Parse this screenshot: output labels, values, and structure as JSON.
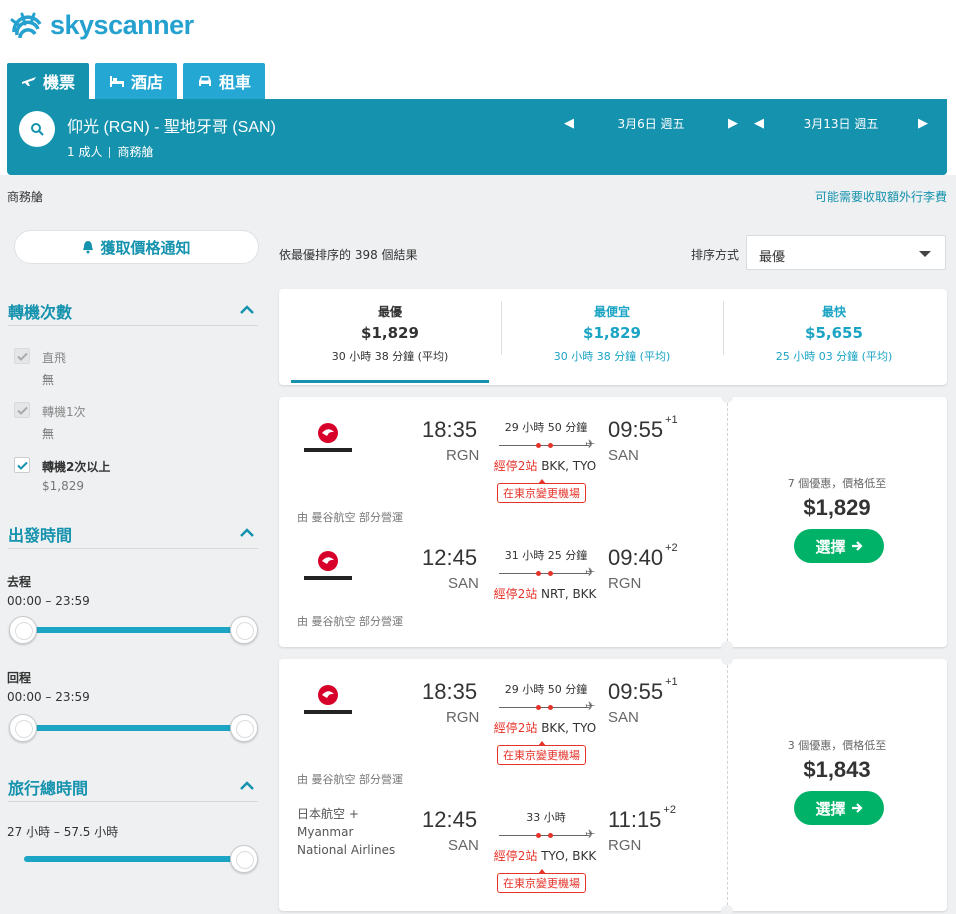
{
  "brand": {
    "name": "skyscanner"
  },
  "tabs": [
    {
      "label": "機票",
      "icon": "plane-icon"
    },
    {
      "label": "酒店",
      "icon": "bed-icon"
    },
    {
      "label": "租車",
      "icon": "car-icon"
    }
  ],
  "search": {
    "route": "仰光 (RGN) - 聖地牙哥 (SAN)",
    "passengers": "1 成人",
    "cabin": "商務艙",
    "depart_date": "3月6日 週五",
    "return_date": "3月13日 週五"
  },
  "subbar": {
    "cabin_label": "商務艙",
    "baggage_link": "可能需要收取額外行李費"
  },
  "sidebar": {
    "alert_button": "獲取價格通知",
    "stops": {
      "title": "轉機次數",
      "options": [
        {
          "label": "直飛",
          "sub": "無",
          "checked": true,
          "disabled": true
        },
        {
          "label": "轉機1次",
          "sub": "無",
          "checked": true,
          "disabled": true
        },
        {
          "label": "轉機2次以上",
          "sub": "$1,829",
          "checked": true,
          "disabled": false
        }
      ]
    },
    "times": {
      "title": "出發時間",
      "outbound_label": "去程",
      "outbound_range": "00:00 – 23:59",
      "return_label": "回程",
      "return_range": "00:00 – 23:59"
    },
    "duration": {
      "title": "旅行總時間",
      "range": "27 小時 – 57.5 小時"
    }
  },
  "results": {
    "count_prefix": "依最優排序的 ",
    "count": "398",
    "count_suffix": " 個結果",
    "sort_label": "排序方式",
    "sort_value": "最優"
  },
  "summary": [
    {
      "title": "最優",
      "price": "$1,829",
      "duration": "30 小時 38 分鐘 (平均)"
    },
    {
      "title": "最便宜",
      "price": "$1,829",
      "duration": "30 小時 38 分鐘 (平均)"
    },
    {
      "title": "最快",
      "price": "$5,655",
      "duration": "25 小時 03 分鐘 (平均)"
    }
  ],
  "cards": [
    {
      "legs": [
        {
          "airline": "JAPAN AIRLINES",
          "dep_time": "18:35",
          "dep_code": "RGN",
          "duration": "29 小時 50 分鐘",
          "stops": "經停2站",
          "via": "BKK, TYO",
          "arr_time": "09:55",
          "arr_offset": "+1",
          "arr_code": "SAN",
          "change": "在東京變更機場",
          "operated": "由 曼谷航空 部分營運"
        },
        {
          "airline": "JAPAN AIRLINES",
          "dep_time": "12:45",
          "dep_code": "SAN",
          "duration": "31 小時 25 分鐘",
          "stops": "經停2站",
          "via": "NRT, BKK",
          "arr_time": "09:40",
          "arr_offset": "+2",
          "arr_code": "RGN",
          "change": "",
          "operated": "由 曼谷航空 部分營運"
        }
      ],
      "deals": "7 個優惠，價格低至",
      "price": "$1,829",
      "select_label": "選擇"
    },
    {
      "legs": [
        {
          "airline": "JAPAN AIRLINES",
          "dep_time": "18:35",
          "dep_code": "RGN",
          "duration": "29 小時 50 分鐘",
          "stops": "經停2站",
          "via": "BKK, TYO",
          "arr_time": "09:55",
          "arr_offset": "+1",
          "arr_code": "SAN",
          "change": "在東京變更機場",
          "operated": "由 曼谷航空 部分營運"
        },
        {
          "airline_text": [
            "日本航空 +",
            "Myanmar",
            "National Airlines"
          ],
          "dep_time": "12:45",
          "dep_code": "SAN",
          "duration": "33 小時",
          "stops": "經停2站",
          "via": "TYO, BKK",
          "arr_time": "11:15",
          "arr_offset": "+2",
          "arr_code": "RGN",
          "change": "在東京變更機場",
          "operated": ""
        }
      ],
      "deals": "3 個優惠，價格低至",
      "price": "$1,843",
      "select_label": "選擇"
    }
  ],
  "colors": {
    "teal": "#1592ad",
    "light_teal": "#25a7d4",
    "green": "#00b268",
    "red": "#e6332a",
    "jal_red": "#d7002a"
  }
}
